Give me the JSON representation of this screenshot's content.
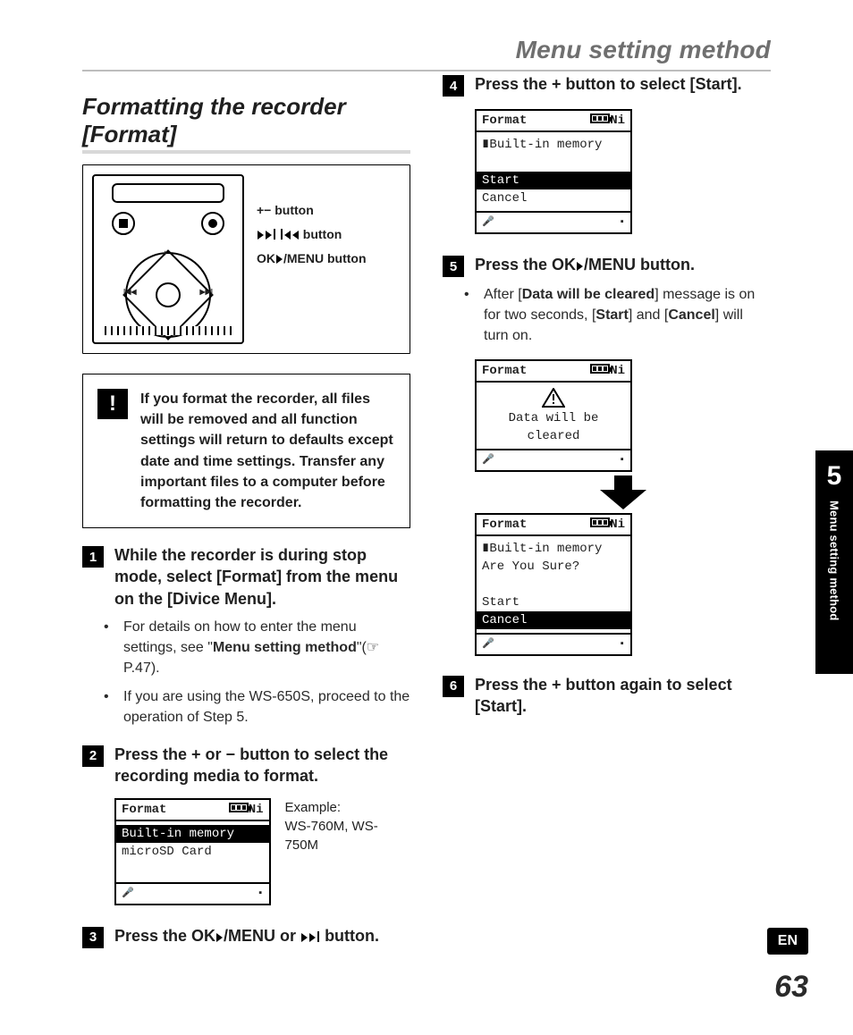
{
  "running_head": "Menu setting method",
  "h1": "Formatting the recorder [Format]",
  "legend": {
    "l1_a": "+− ",
    "l1_b": "button",
    "l2_b": "button",
    "l3_a": "OK",
    "l3_c": "/MENU button"
  },
  "note": {
    "bang": "!",
    "text": "If you format the recorder, all files will be removed and all function settings will return to defaults except date and time settings. Transfer any important files to a computer before formatting the recorder."
  },
  "steps": {
    "s1": {
      "num": "1",
      "t_a": "While the recorder is during stop mode, select [",
      "t_b": "Format",
      "t_c": "] from the menu on the [",
      "t_d": "Divice Menu",
      "t_e": "]."
    },
    "s1_b1_a": "For details on how to enter the menu settings, see \"",
    "s1_b1_b": "Menu setting method",
    "s1_b1_c": "\"(☞ P.47).",
    "s1_b2": "If you are using the WS-650S, proceed to the operation of Step 5.",
    "s2": {
      "num": "2",
      "t": "Press the + or − button to select the recording media to format."
    },
    "s2_cap": "Example:\nWS-760M, WS-750M",
    "s3": {
      "num": "3",
      "t_a": "Press the ",
      "t_b": "OK",
      "t_c": "/MENU or ",
      "t_d": " button."
    },
    "s4": {
      "num": "4",
      "t_a": "Press the + button to select [",
      "t_b": "Start",
      "t_c": "]."
    },
    "s5": {
      "num": "5",
      "t_a": "Press the ",
      "t_b": "OK",
      "t_c": "/MENU button."
    },
    "s5_b1_a": "After [",
    "s5_b1_b": "Data will be cleared",
    "s5_b1_c": "] message is on for two seconds, [",
    "s5_b1_d": "Start",
    "s5_b1_e": "] and [",
    "s5_b1_f": "Cancel",
    "s5_b1_g": "] will turn on.",
    "s6": {
      "num": "6",
      "t_a": "Press the + button again to select [",
      "t_b": "Start",
      "t_c": "]."
    }
  },
  "lcd_a": {
    "title": "Format",
    "mode": "Ni",
    "sel": "Built-in memory",
    "row2": "microSD Card"
  },
  "lcd_b": {
    "title": "Format",
    "mode": "Ni",
    "row1": "∎Built-in memory",
    "sel": "Start",
    "row3": "Cancel"
  },
  "lcd_c": {
    "title": "Format",
    "mode": "Ni",
    "row1": "Data will be",
    "row2": "cleared"
  },
  "lcd_d": {
    "title": "Format",
    "mode": "Ni",
    "row1": "∎Built-in memory",
    "row2": "Are You Sure?",
    "row3": "Start",
    "sel": "Cancel"
  },
  "side": {
    "num": "5",
    "label": "Menu setting method"
  },
  "lang": "EN",
  "page": "63"
}
